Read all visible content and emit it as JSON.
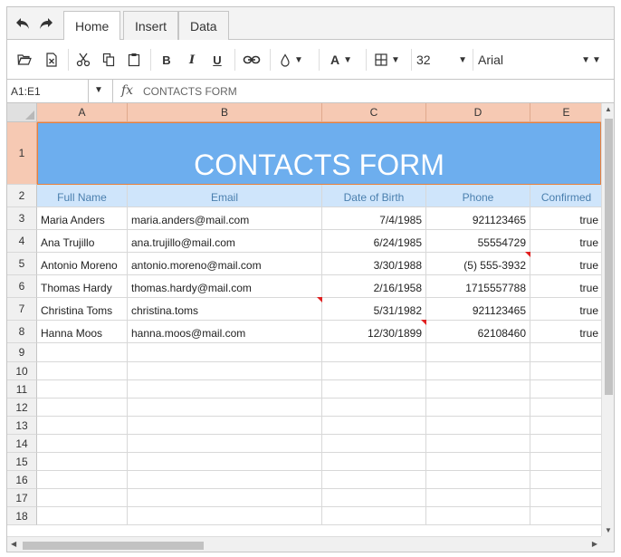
{
  "tabs": [
    {
      "label": "Home",
      "active": true
    },
    {
      "label": "Insert",
      "active": false
    },
    {
      "label": "Data",
      "active": false
    }
  ],
  "toolbar": {
    "icons": [
      "open-icon",
      "export-icon",
      "cut-icon",
      "copy-icon",
      "paste-icon",
      "bold-icon",
      "italic-icon",
      "underline-icon",
      "hyperlink-icon",
      "fill-color-icon",
      "font-color-icon",
      "borders-icon"
    ],
    "bold_label": "B",
    "italic_label": "I",
    "underline_label": "U",
    "font_color_label": "A",
    "font_size": "32",
    "font_family": "Arial"
  },
  "formula_bar": {
    "name_box": "A1:E1",
    "fx_label": "fx",
    "formula": "CONTACTS FORM"
  },
  "columns": [
    "A",
    "B",
    "C",
    "D",
    "E"
  ],
  "row_numbers": [
    "1",
    "2",
    "3",
    "4",
    "5",
    "6",
    "7",
    "8",
    "9",
    "10",
    "11",
    "12",
    "13",
    "14",
    "15",
    "16",
    "17",
    "18"
  ],
  "sheet": {
    "title": "CONTACTS FORM",
    "headers": [
      "Full Name",
      "Email",
      "Date of Birth",
      "Phone",
      "Confirmed"
    ],
    "rows": [
      [
        "Maria Anders",
        "maria.anders@mail.com",
        "7/4/1985",
        "921123465",
        "true"
      ],
      [
        "Ana Trujillo",
        "ana.trujillo@mail.com",
        "6/24/1985",
        "55554729",
        "true"
      ],
      [
        "Antonio Moreno",
        "antonio.moreno@mail.com",
        "3/30/1988",
        "(5) 555-3932",
        "true"
      ],
      [
        "Thomas Hardy",
        "thomas.hardy@mail.com",
        "2/16/1958",
        "1715557788",
        "true"
      ],
      [
        "Christina Toms",
        "christina.toms",
        "5/31/1982",
        "921123465",
        "true"
      ],
      [
        "Hanna Moos",
        "hanna.moos@mail.com",
        "12/30/1899",
        "62108460",
        "true"
      ]
    ]
  },
  "colors": {
    "title_fill": "#6daeee",
    "header_fill": "#cfe5fb",
    "column_header_fill": "#f6c9b3",
    "selection_border": "#e9803a",
    "note_marker": "#e02020"
  }
}
